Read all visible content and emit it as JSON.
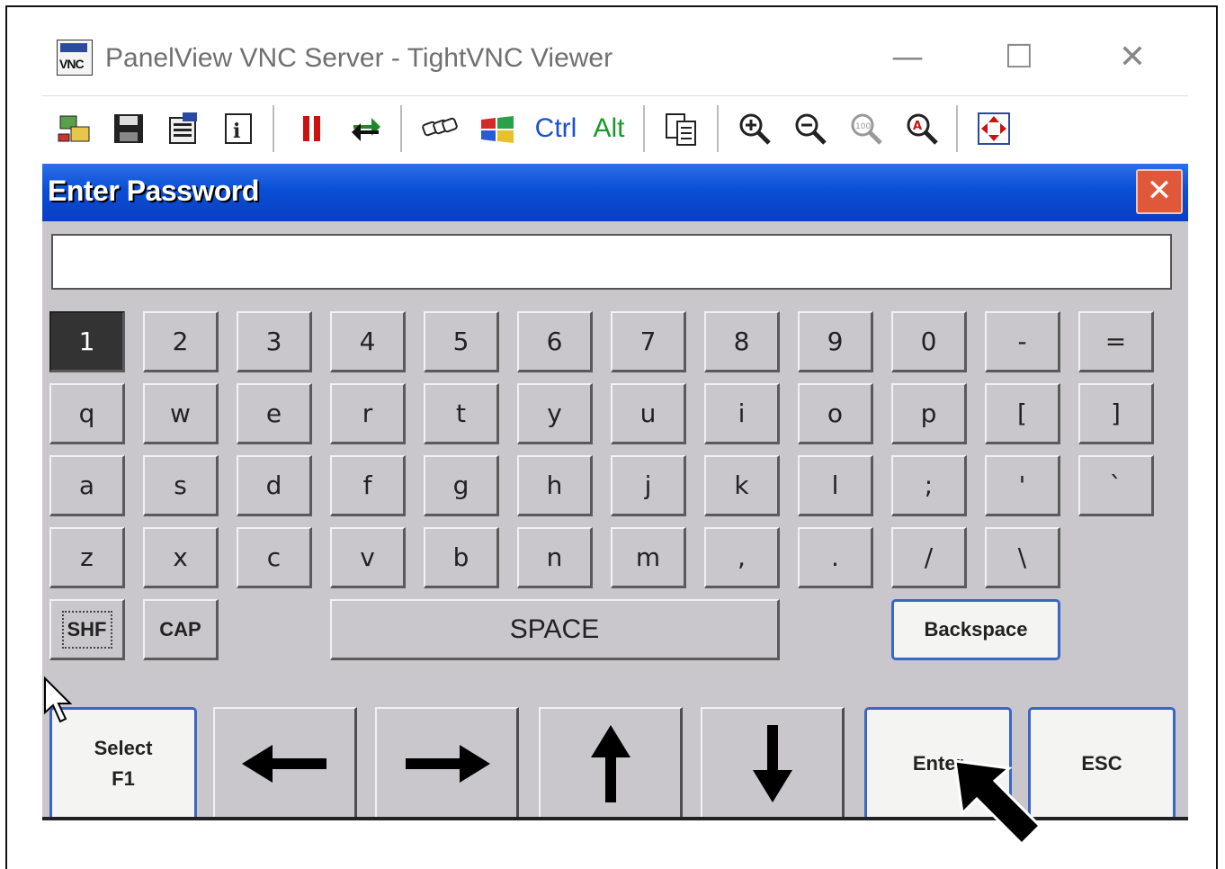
{
  "window": {
    "title": "PanelView VNC Server - TightVNC Viewer",
    "app_icon_text": "VNC"
  },
  "toolbar": {
    "ctrl_label": "Ctrl",
    "alt_label": "Alt"
  },
  "dialog": {
    "title": "Enter Password",
    "password_value": ""
  },
  "keyboard": {
    "row1": [
      "1",
      "2",
      "3",
      "4",
      "5",
      "6",
      "7",
      "8",
      "9",
      "0",
      "-",
      "="
    ],
    "row2": [
      "q",
      "w",
      "e",
      "r",
      "t",
      "y",
      "u",
      "i",
      "o",
      "p",
      "[",
      "]"
    ],
    "row3": [
      "a",
      "s",
      "d",
      "f",
      "g",
      "h",
      "j",
      "k",
      "l",
      ";",
      "'",
      "`"
    ],
    "row4": [
      "z",
      "x",
      "c",
      "v",
      "b",
      "n",
      "m",
      ",",
      ".",
      "/",
      "\\"
    ],
    "shift": "SHF",
    "caps": "CAP",
    "space": "SPACE",
    "backspace": "Backspace",
    "select_line1": "Select",
    "select_line2": "F1",
    "enter": "Enter",
    "esc": "ESC"
  },
  "colors": {
    "title_bar": "#0a4fd6",
    "close_button": "#e0573a",
    "key_face": "#c9c7cc",
    "pressed_key": "#333333"
  }
}
